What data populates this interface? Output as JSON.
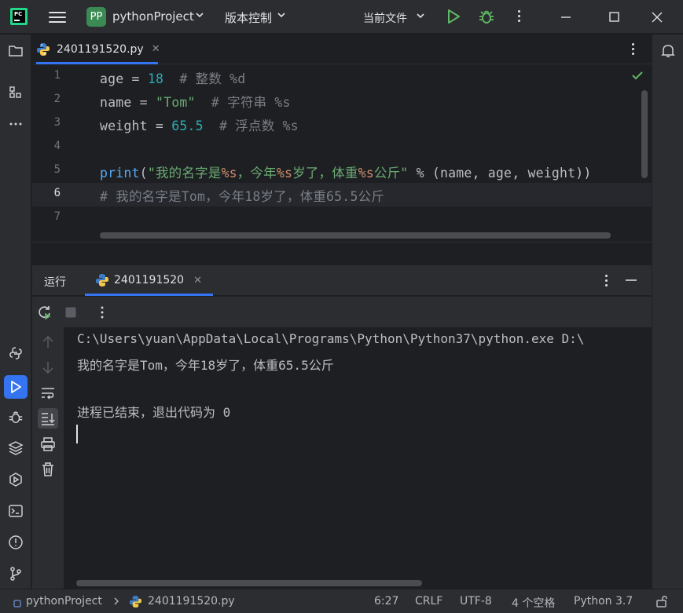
{
  "titlebar": {
    "project_badge": "PP",
    "project_name": "pythonProject",
    "vcs_label": "版本控制",
    "run_config_label": "当前文件"
  },
  "editor": {
    "tab_label": "2401191520.py",
    "line_numbers": [
      "1",
      "2",
      "3",
      "4",
      "5",
      "6",
      "7"
    ],
    "current_line": 6
  },
  "run_panel": {
    "title": "运行",
    "tab_label": "2401191520",
    "output_lines": [
      "C:\\Users\\yuan\\AppData\\Local\\Programs\\Python\\Python37\\python.exe D:\\",
      "我的名字是Tom，今年18岁了，体重65.5公斤",
      "",
      "进程已结束，退出代码为 0"
    ]
  },
  "statusbar": {
    "breadcrumb_project": "pythonProject",
    "breadcrumb_file": "2401191520.py",
    "cursor_pos": "6:27",
    "line_sep": "CRLF",
    "encoding": "UTF-8",
    "indent": "4 个空格",
    "interpreter": "Python 3.7"
  },
  "colors": {
    "accent": "#3574f0",
    "run_green": "#5fb865",
    "background": "#1e1f22",
    "panel": "#2b2d30"
  },
  "icons": [
    "pycharm-logo",
    "menu-icon",
    "run-icon",
    "debug-icon",
    "more-icon",
    "minimize-icon",
    "maximize-icon",
    "close-icon",
    "folder-icon",
    "structure-icon",
    "python-console-icon",
    "run-tool-icon",
    "debug-tool-icon",
    "layers-icon",
    "services-icon",
    "terminal-icon",
    "problems-icon",
    "git-icon",
    "notifications-icon",
    "rerun-icon",
    "stop-icon",
    "up-arrow-icon",
    "down-arrow-icon",
    "soft-wrap-icon",
    "scroll-to-end-icon",
    "print-icon",
    "trash-icon",
    "lock-icon"
  ]
}
